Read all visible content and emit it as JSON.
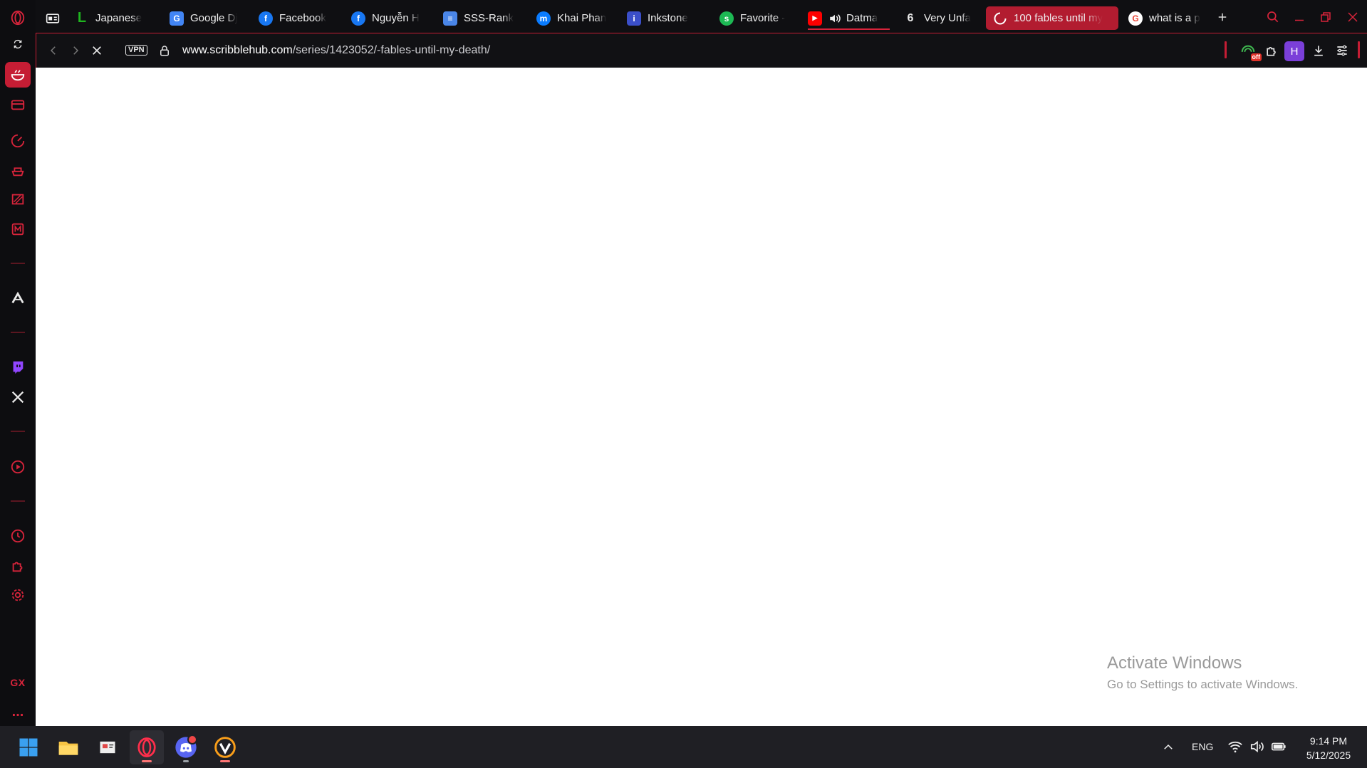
{
  "sidebar": {
    "items": [
      {
        "name": "opera-logo-icon"
      },
      {
        "name": "sync-icon"
      },
      {
        "name": "gx-corner-icon"
      },
      {
        "name": "wallet-icon"
      },
      {
        "name": "speed-dial-icon"
      },
      {
        "name": "player-icon"
      },
      {
        "name": "twitch-sidebar-icon"
      },
      {
        "name": "mail-icon"
      }
    ],
    "bottom_logo": "GX",
    "more": "..."
  },
  "tabs": [
    {
      "label": "Japanese",
      "favicon": "L",
      "color": "#1fb51f"
    },
    {
      "label": "Google Dj",
      "favicon": "G",
      "color": "#4285f4"
    },
    {
      "label": "Facebook",
      "favicon": "f",
      "color": "#1877f2"
    },
    {
      "label": "Nguyễn H",
      "favicon": "f",
      "color": "#1877f2"
    },
    {
      "label": "SSS-Rank",
      "favicon": "≡",
      "color": "#4a86e8"
    },
    {
      "label": "Khai Phan",
      "favicon": "m",
      "color": "#0a7cff"
    },
    {
      "label": "Inkstone",
      "favicon": "i",
      "color": "#3b4fc9"
    },
    {
      "label": "Favorite -",
      "favicon": "s",
      "color": "#1db954"
    },
    {
      "label": "Datma",
      "favicon": "▶",
      "color": "#ff0000"
    },
    {
      "label": "Very Unfa",
      "favicon": "6",
      "color": "#eaeaea"
    },
    {
      "label": "100 fables until my",
      "favicon": "loading",
      "color": "#ffffff"
    },
    {
      "label": "what is a p",
      "favicon": "G",
      "color": "#ea4335"
    }
  ],
  "address_bar": {
    "vpn": "VPN",
    "url_host": "www.scribblehub.com",
    "url_path": "/series/1423052/-fables-until-my-death/",
    "adblock_badge": "off",
    "profile_initial": "H"
  },
  "watermark": {
    "title": "Activate Windows",
    "subtitle": "Go to Settings to activate Windows."
  },
  "taskbar": {
    "apps": [
      "windows-start",
      "file-explorer",
      "snipping-tool",
      "opera-gx",
      "discord",
      "overwatch"
    ],
    "language": "ENG",
    "time": "9:14 PM",
    "date": "5/12/2025"
  },
  "colors": {
    "accent": "#c51d34",
    "content_bg": "#ffffff",
    "chrome_bg": "#0f0f12"
  }
}
